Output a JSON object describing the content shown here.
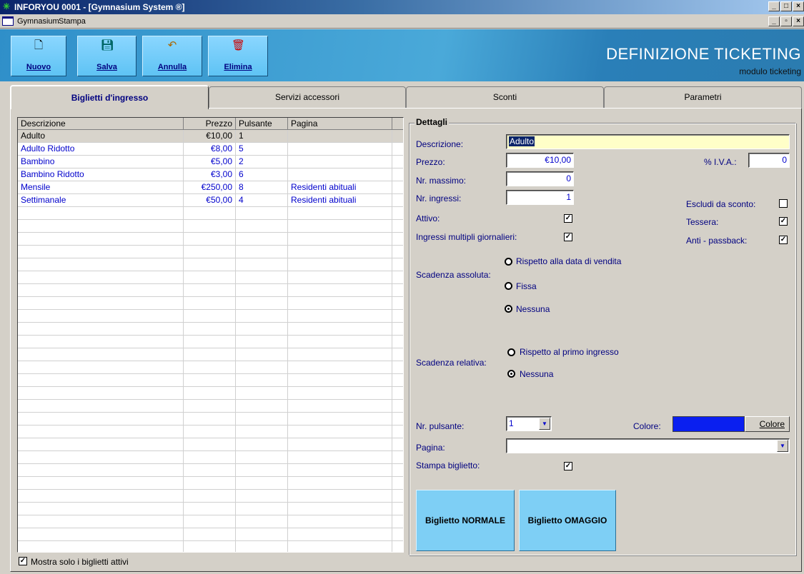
{
  "window": {
    "title": "INFORYOU 0001 - [Gymnasium System ®]",
    "controls": [
      "_",
      "□",
      "×"
    ],
    "mdi_controls": [
      "_",
      "▫",
      "×"
    ]
  },
  "menu": {
    "items": [
      "Gymnasium",
      "Stampa"
    ]
  },
  "toolbar": {
    "buttons": [
      {
        "label": "Nuovo",
        "icon": "new-document-icon"
      },
      {
        "label": "Salva",
        "icon": "floppy-disk-icon"
      },
      {
        "label": "Annulla",
        "icon": "undo-arrow-icon"
      },
      {
        "label": "Elimina",
        "icon": "trash-bin-icon"
      }
    ],
    "header_title": "DEFINIZIONE TICKETING",
    "header_subtitle": "modulo ticketing"
  },
  "tabs": [
    {
      "label": "Biglietti d'ingresso",
      "active": true
    },
    {
      "label": "Servizi accessori",
      "active": false
    },
    {
      "label": "Sconti",
      "active": false
    },
    {
      "label": "Parametri",
      "active": false
    }
  ],
  "grid": {
    "columns": [
      "Descrizione",
      "Prezzo",
      "Pulsante",
      "Pagina"
    ],
    "rows": [
      {
        "descrizione": "Adulto",
        "prezzo": "€10,00",
        "pulsante": "1",
        "pagina": ""
      },
      {
        "descrizione": "Adulto Ridotto",
        "prezzo": "€8,00",
        "pulsante": "5",
        "pagina": ""
      },
      {
        "descrizione": "Bambino",
        "prezzo": "€5,00",
        "pulsante": "2",
        "pagina": ""
      },
      {
        "descrizione": "Bambino Ridotto",
        "prezzo": "€3,00",
        "pulsante": "6",
        "pagina": ""
      },
      {
        "descrizione": "Mensile",
        "prezzo": "€250,00",
        "pulsante": "8",
        "pagina": "Residenti abituali"
      },
      {
        "descrizione": "Settimanale",
        "prezzo": "€50,00",
        "pulsante": "4",
        "pagina": "Residenti abituali"
      }
    ],
    "show_active_only_label": "Mostra solo i biglietti attivi",
    "show_active_only_checked": true
  },
  "details": {
    "legend": "Dettagli",
    "descrizione_label": "Descrizione:",
    "descrizione_value": "Adulto",
    "prezzo_label": "Prezzo:",
    "prezzo_value": "€10,00",
    "iva_label": "% I.V.A.:",
    "iva_value": "0",
    "nr_massimo_label": "Nr. massimo:",
    "nr_massimo_value": "0",
    "nr_ingressi_label": "Nr. ingressi:",
    "nr_ingressi_value": "1",
    "escludi_label": "Escludi da sconto:",
    "escludi_checked": false,
    "attivo_label": "Attivo:",
    "attivo_checked": true,
    "tessera_label": "Tessera:",
    "tessera_checked": true,
    "multipli_label": "Ingressi multipli giornalieri:",
    "multipli_checked": true,
    "antipassback_label": "Anti - passback:",
    "antipassback_checked": true,
    "scad_assoluta_label": "Scadenza assoluta:",
    "scad_assoluta_options": [
      "Rispetto alla data di vendita",
      "Fissa",
      "Nessuna"
    ],
    "scad_assoluta_selected": "Nessuna",
    "scad_relativa_label": "Scadenza relativa:",
    "scad_relativa_options": [
      "Rispetto al primo ingresso",
      "Nessuna"
    ],
    "scad_relativa_selected": "Nessuna",
    "nr_pulsante_label": "Nr. pulsante:",
    "nr_pulsante_value": "1",
    "colore_label": "Colore:",
    "colore_swatch": "#0a1ff0",
    "colore_button": "Colore",
    "pagina_label": "Pagina:",
    "pagina_value": "",
    "stampa_label": "Stampa biglietto:",
    "stampa_checked": true,
    "btn_normale": "Biglietto NORMALE",
    "btn_omaggio": "Biglietto OMAGGIO"
  }
}
